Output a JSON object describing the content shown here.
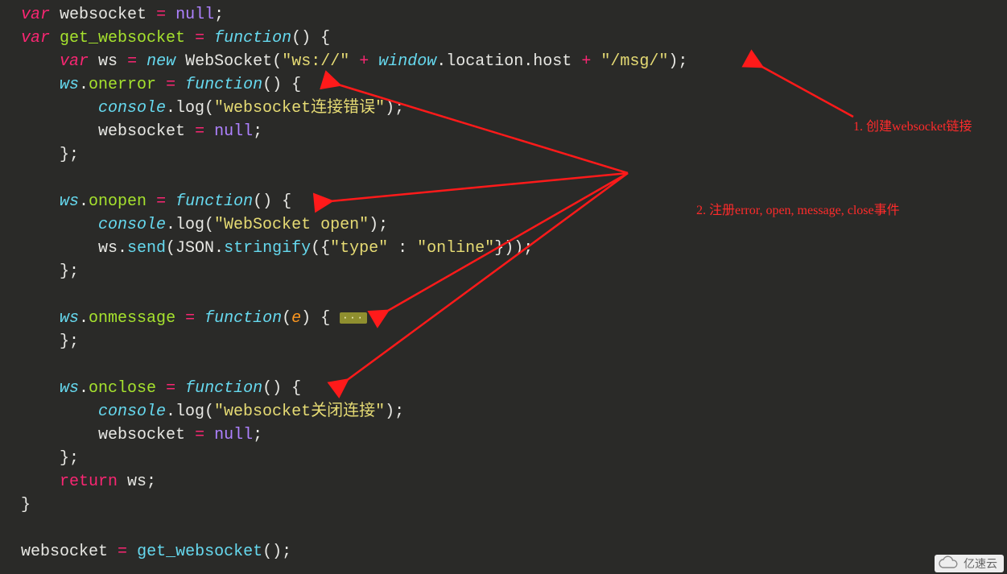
{
  "code": {
    "l1": {
      "var": "var",
      "ws": "websocket",
      "eq": "=",
      "null": "null",
      "semi": ";"
    },
    "l2": {
      "var": "var",
      "gw": "get_websocket",
      "eq": "=",
      "func": "function",
      "par": "()",
      "brace": "{"
    },
    "l3": {
      "var": "var",
      "ws": "ws",
      "eq": "=",
      "new": "new",
      "cls": "WebSocket",
      "lp": "(",
      "s1": "\"ws://\"",
      "plus": "+",
      "win": "window",
      "loc": ".location.host",
      "plus2": "+",
      "s2": "\"/msg/\"",
      "rp": ");"
    },
    "l4": {
      "ws": "ws",
      "dot": ".",
      "prop": "onerror",
      "eq": "=",
      "func": "function",
      "par": "()",
      "brace": "{"
    },
    "l5": {
      "con": "console",
      "log": ".log(",
      "s": "\"websocket连接错误\"",
      "rp": ");"
    },
    "l6": {
      "ws": "websocket",
      "eq": "=",
      "null": "null",
      "semi": ";"
    },
    "l7": {
      "brace": "};"
    },
    "l9": {
      "ws": "ws",
      "dot": ".",
      "prop": "onopen",
      "eq": "=",
      "func": "function",
      "par": "()",
      "brace": "{"
    },
    "l10": {
      "con": "console",
      "log": ".log(",
      "s": "\"WebSocket open\"",
      "rp": ");"
    },
    "l11": {
      "ws": "ws.",
      "send": "send",
      "lp": "(JSON.",
      "str": "stringify",
      "inner": "({",
      "k": "\"type\"",
      "colon": ":",
      "v": "\"online\"",
      "rp": "}));"
    },
    "l12": {
      "brace": "};"
    },
    "l14": {
      "ws": "ws",
      "dot": ".",
      "prop": "onmessage",
      "eq": "=",
      "func": "function",
      "lp": "(",
      "p": "e",
      "rp": ")",
      "brace": "{",
      "fold": "···"
    },
    "l15": {
      "brace": "};"
    },
    "l17": {
      "ws": "ws",
      "dot": ".",
      "prop": "onclose",
      "eq": "=",
      "func": "function",
      "par": "()",
      "brace": "{"
    },
    "l18": {
      "con": "console",
      "log": ".log(",
      "s": "\"websocket关闭连接\"",
      "rp": ");"
    },
    "l19": {
      "ws": "websocket",
      "eq": "=",
      "null": "null",
      "semi": ";"
    },
    "l20": {
      "brace": "};"
    },
    "l21": {
      "ret": "return",
      "ws": "ws;"
    },
    "l22": {
      "brace": "}"
    },
    "l24": {
      "ws": "websocket",
      "eq": "=",
      "gw": "get_websocket",
      "par": "();"
    }
  },
  "annotations": {
    "a1": "1. 创建websocket链接",
    "a2": "2. 注册error, open, message, close事件"
  },
  "watermark": "亿速云"
}
